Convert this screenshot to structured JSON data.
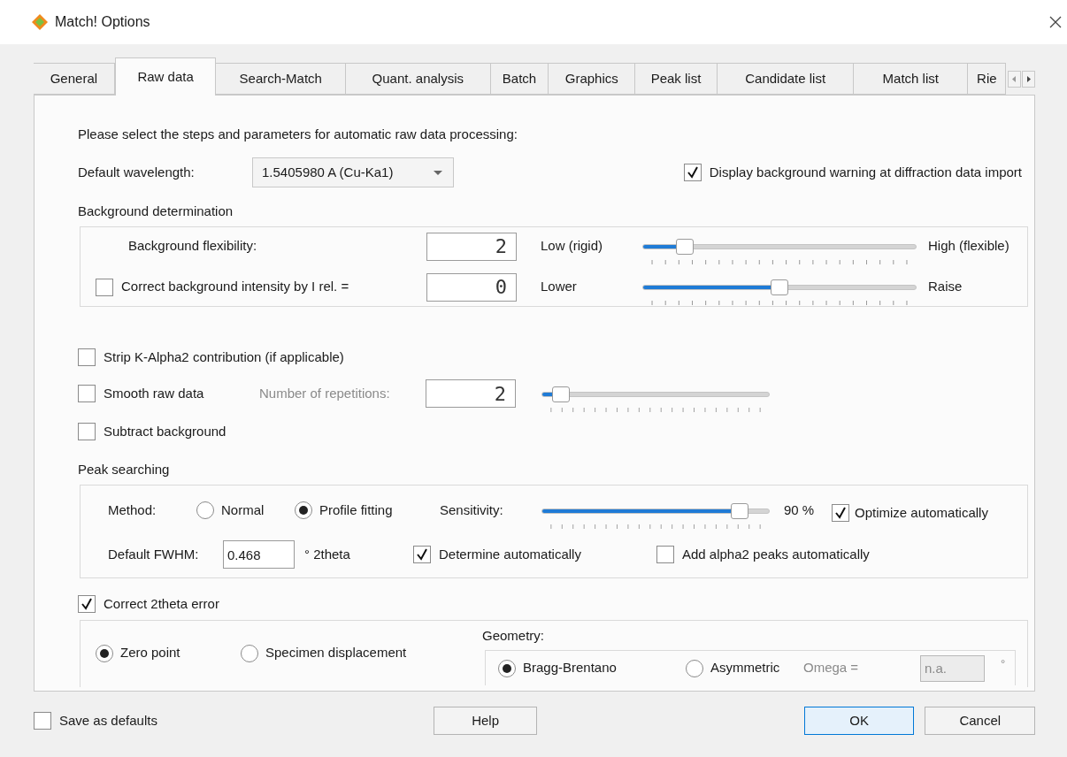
{
  "window": {
    "title": "Match! Options"
  },
  "tabs": [
    {
      "label": "General",
      "selected": false
    },
    {
      "label": "Raw data",
      "selected": true
    },
    {
      "label": "Search-Match",
      "selected": false
    },
    {
      "label": "Quant. analysis",
      "selected": false
    },
    {
      "label": "Batch",
      "selected": false
    },
    {
      "label": "Graphics",
      "selected": false
    },
    {
      "label": "Peak list",
      "selected": false
    },
    {
      "label": "Candidate list",
      "selected": false
    },
    {
      "label": "Match list",
      "selected": false
    },
    {
      "label": "Rie",
      "selected": false
    }
  ],
  "intro": "Please select the steps and parameters for automatic raw data processing:",
  "wavelength": {
    "label": "Default wavelength:",
    "value": "1.5405980 A (Cu-Ka1)"
  },
  "background_warning": {
    "label": "Display background warning at diffraction data import",
    "checked": true
  },
  "background_determination": {
    "title": "Background determination",
    "rows": [
      {
        "kind": "plain",
        "label": "Background flexibility:",
        "value": "2",
        "low_label": "Low (rigid)",
        "high_label": "High (flexible)",
        "level": 0.13
      },
      {
        "kind": "checkbox",
        "checked": false,
        "label": "Correct background intensity by I rel. =",
        "value": "0",
        "low_label": "Lower",
        "high_label": "Raise",
        "level": 0.5
      }
    ]
  },
  "options": [
    {
      "label": "Strip K-Alpha2 contribution (if applicable)",
      "checked": false
    },
    {
      "label": "Smooth raw data",
      "checked": false,
      "repetitions": {
        "label": "Number of repetitions:",
        "disabled": true,
        "value": "2",
        "level": 0.05
      }
    },
    {
      "label": "Subtract background",
      "checked": false
    }
  ],
  "peak_searching": {
    "title": "Peak searching",
    "method_label": "Method:",
    "methods": [
      {
        "label": "Normal",
        "selected": false
      },
      {
        "label": "Profile fitting",
        "selected": true
      }
    ],
    "sensitivity": {
      "label": "Sensitivity:",
      "level": 0.9,
      "reading": "90 %"
    },
    "optimize": {
      "label": "Optimize automatically",
      "checked": true
    },
    "fwhm": {
      "label": "Default FWHM:",
      "value": "0.468",
      "unit": "° 2theta"
    },
    "determine": {
      "label": "Determine automatically",
      "checked": true
    },
    "add_alpha2": {
      "label": "Add alpha2 peaks automatically",
      "checked": false
    }
  },
  "correct_2theta": {
    "label": "Correct 2theta error",
    "checked": true,
    "modes": [
      {
        "label": "Zero point",
        "selected": true
      },
      {
        "label": "Specimen displacement",
        "selected": false
      }
    ],
    "geometry": {
      "label": "Geometry:",
      "options": [
        {
          "label": "Bragg-Brentano",
          "selected": true
        },
        {
          "label": "Asymmetric",
          "selected": false
        }
      ],
      "omega": {
        "label": "Omega =",
        "value": "n.a.",
        "unit": "°",
        "disabled": true
      }
    }
  },
  "footer": {
    "save_defaults": {
      "label": "Save as defaults",
      "checked": false
    },
    "buttons": [
      {
        "label": "Help",
        "default": false
      },
      {
        "label": "OK",
        "default": true
      },
      {
        "label": "Cancel",
        "default": false
      }
    ]
  }
}
